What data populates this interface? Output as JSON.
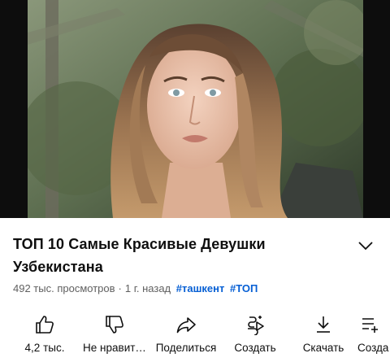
{
  "video": {
    "title": "ТОП 10 Самые Красивые Девушки Узбекистана",
    "views": "492 тыс. просмотров",
    "age": "1 г. назад",
    "hashtags": [
      "#ташкент",
      "#ТОП"
    ]
  },
  "actions": {
    "like_count": "4,2 тыс.",
    "dislike_label": "Не нравит…",
    "share_label": "Поделиться",
    "create_label": "Создать",
    "download_label": "Скачать",
    "save_label": "Созда"
  },
  "icons": {
    "expand": "chevron-down-icon",
    "like": "thumbs-up-icon",
    "dislike": "thumbs-down-icon",
    "share": "share-arrow-icon",
    "create": "remix-icon",
    "download": "download-icon",
    "save": "save-icon"
  }
}
